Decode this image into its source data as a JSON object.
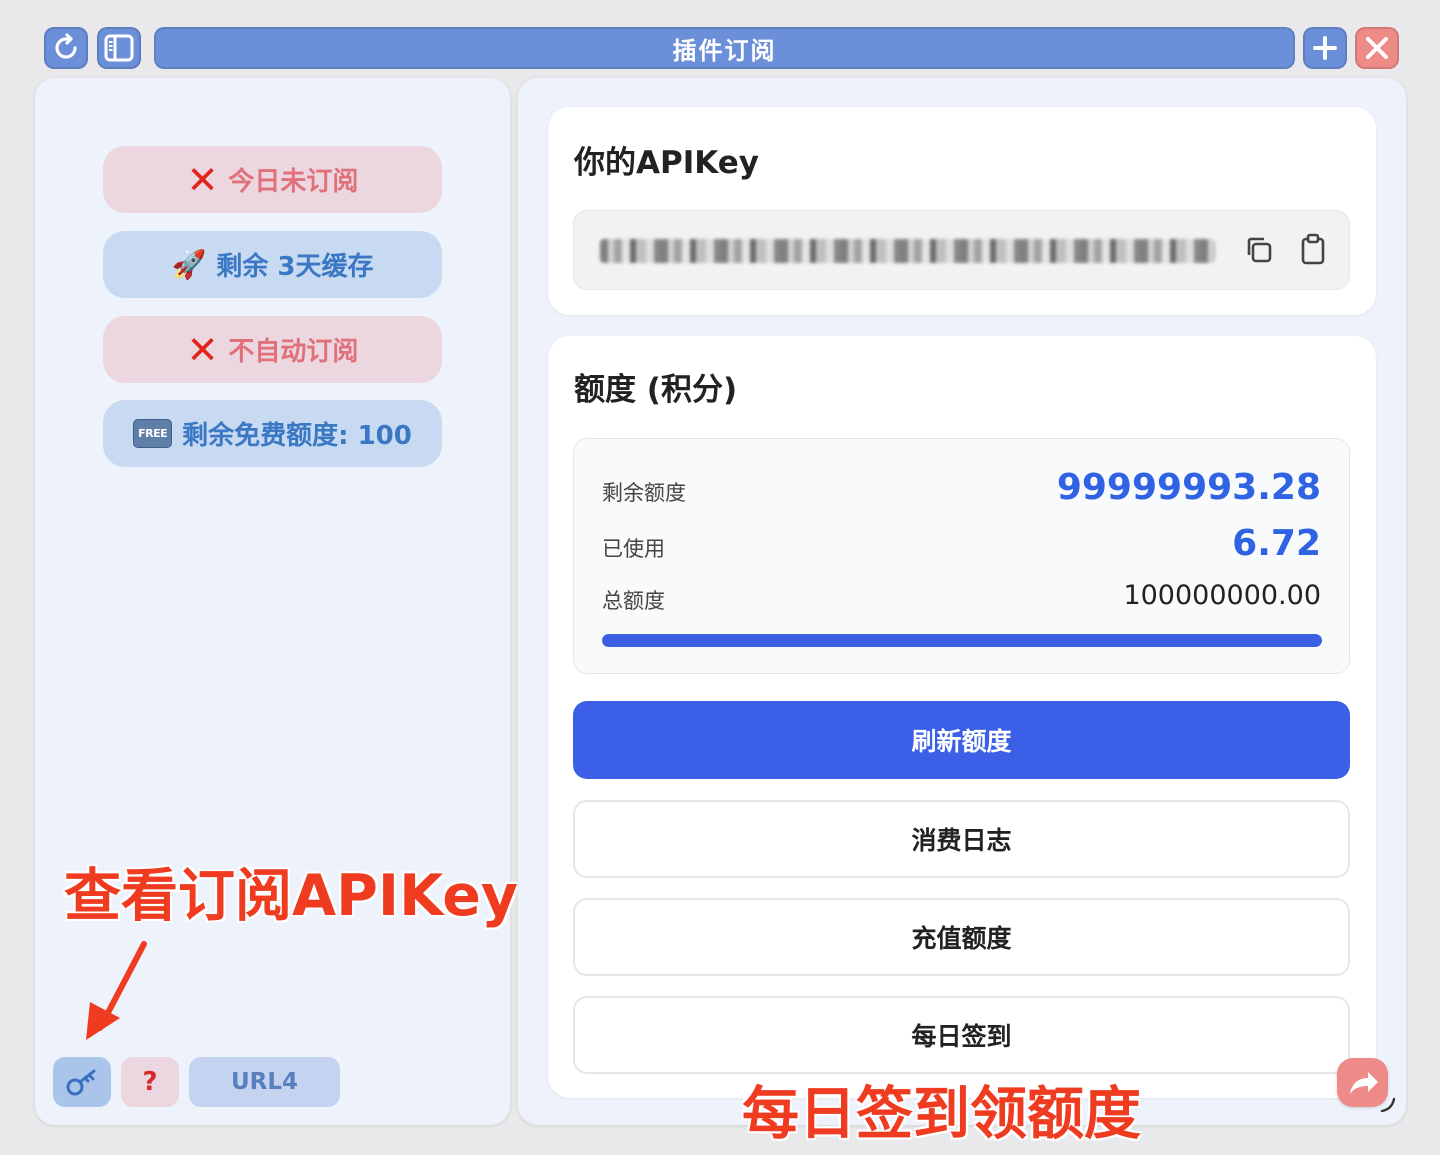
{
  "window": {
    "title": "插件订阅"
  },
  "status_pills": [
    {
      "icon": "cross-mark-icon",
      "label": "今日未订阅"
    },
    {
      "icon": "rocket-icon",
      "emoji": "🚀",
      "label": "剩余 3天缓存"
    },
    {
      "icon": "cross-mark-icon",
      "label": "不自动订阅"
    },
    {
      "icon": "free-badge-icon",
      "badge": "FREE",
      "label": "剩余免费额度: 100"
    }
  ],
  "left_bottom": {
    "help_label": "?",
    "url_label": "URL4"
  },
  "api_key_card": {
    "title": "你的APIKey"
  },
  "quota_card": {
    "title": "额度 (积分)",
    "remaining_label": "剩余额度",
    "remaining_value": "99999993.28",
    "used_label": "已使用",
    "used_value": "6.72",
    "total_label": "总额度",
    "total_value": "100000000.00",
    "progress_fraction": 0.9999999,
    "refresh_label": "刷新额度",
    "log_label": "消费日志",
    "recharge_label": "充值额度",
    "checkin_label": "每日签到"
  },
  "annotations": {
    "view_key": "查看订阅APIKey",
    "checkin_tip": "每日签到领额度"
  },
  "colors": {
    "accent_blue": "#3b5fe6",
    "title_bar": "#6c8fd9",
    "close_red": "#ee8a87",
    "annotation_red": "#ef3b1f"
  }
}
